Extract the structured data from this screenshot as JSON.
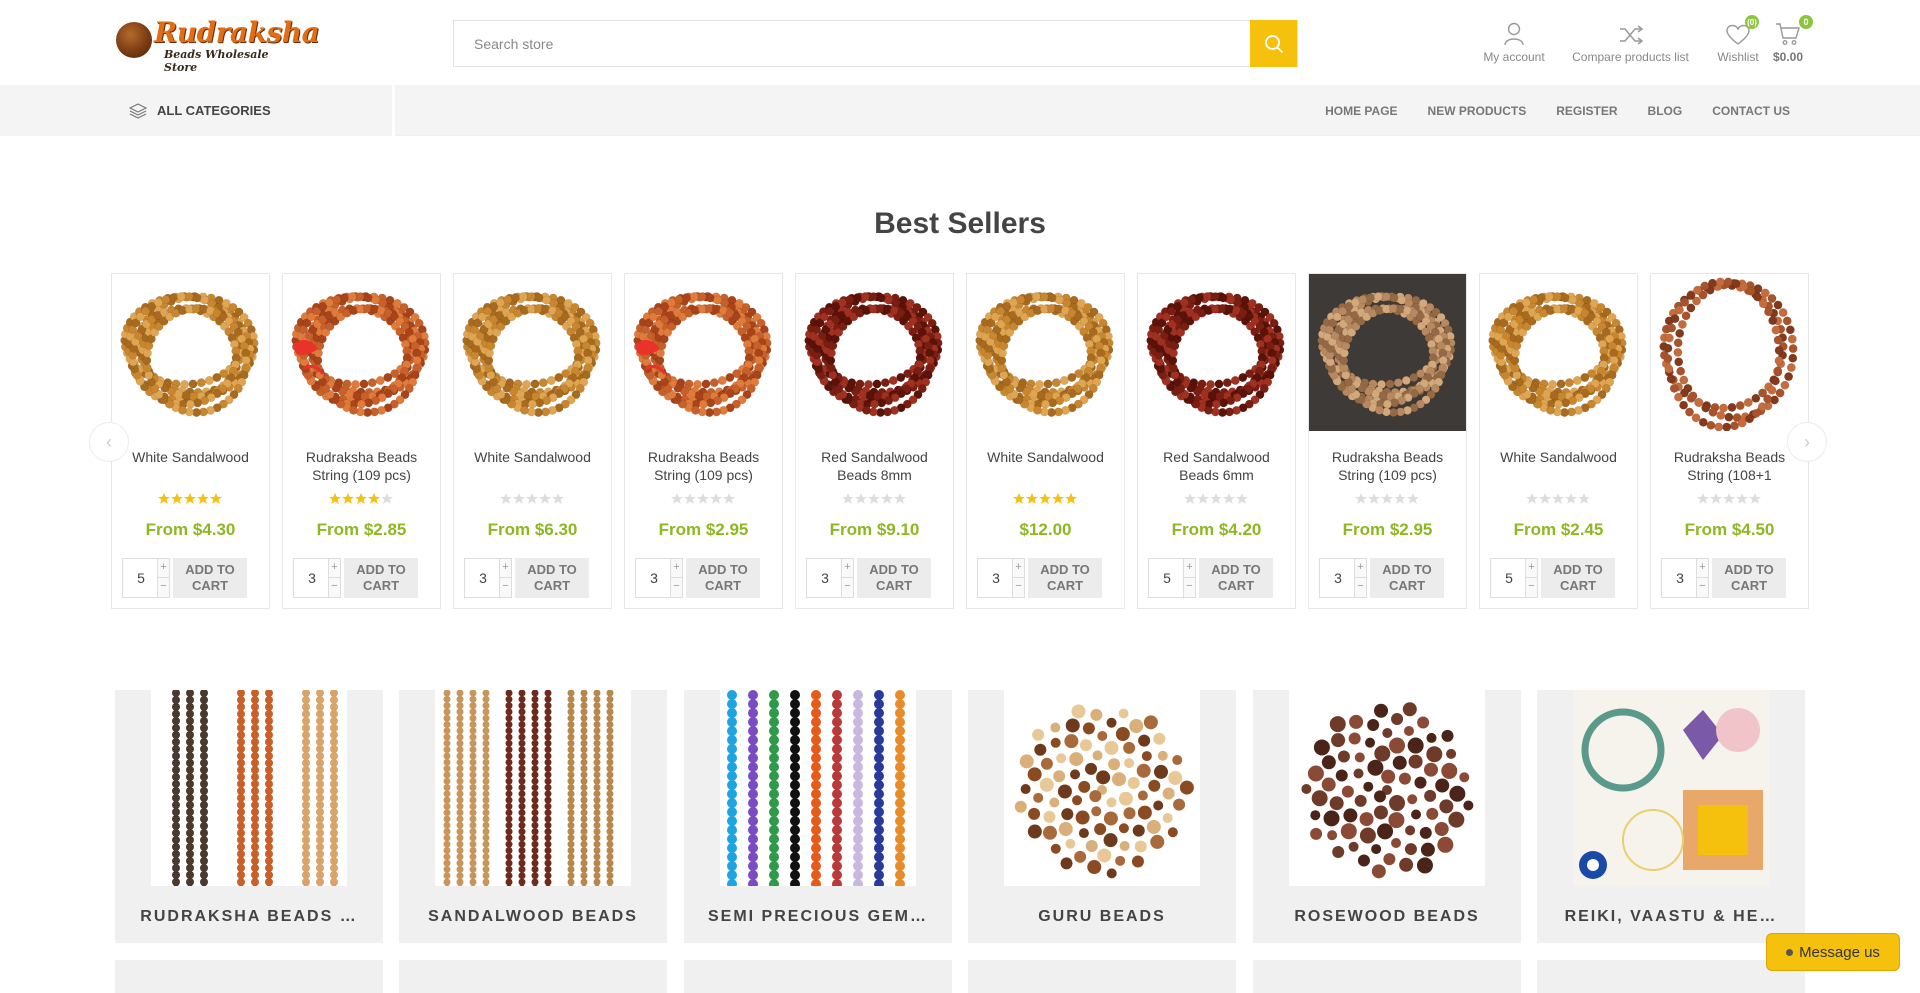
{
  "logo": {
    "title": "Rudraksha",
    "subtitle": "Beads Wholesale Store"
  },
  "search": {
    "placeholder": "Search store"
  },
  "header_links": {
    "account": "My account",
    "compare": "Compare products list",
    "wishlist": "Wishlist",
    "wishlist_count": "(0)",
    "cart_count": "0",
    "cart_total": "$0.00"
  },
  "nav": {
    "categories_label": "ALL CATEGORIES",
    "menu": [
      "HOME PAGE",
      "NEW PRODUCTS",
      "REGISTER",
      "BLOG",
      "CONTACT US"
    ]
  },
  "best_sellers": {
    "title": "Best Sellers",
    "add_to_cart": "ADD TO CART",
    "products": [
      {
        "name": "White Sandalwood",
        "price": "From $4.30",
        "rating": 5,
        "qty": "5",
        "image": "white-sandalwood-strings"
      },
      {
        "name": "Rudraksha Beads String (109 pcs)",
        "price": "From $2.85",
        "rating": 4,
        "qty": "3",
        "image": "rudraksha-strings"
      },
      {
        "name": "White Sandalwood",
        "price": "From $6.30",
        "rating": 0,
        "qty": "3",
        "image": "white-sandalwood-strings"
      },
      {
        "name": "Rudraksha Beads String (109 pcs)",
        "price": "From $2.95",
        "rating": 0,
        "qty": "3",
        "image": "rudraksha-strings"
      },
      {
        "name": "Red Sandalwood Beads 8mm",
        "price": "From $9.10",
        "rating": 0,
        "qty": "3",
        "image": "red-sandalwood-strings"
      },
      {
        "name": "White Sandalwood",
        "price": "$12.00",
        "rating": 5,
        "qty": "3",
        "image": "white-sandalwood-strings"
      },
      {
        "name": "Red Sandalwood Beads 6mm",
        "price": "From $4.20",
        "rating": 0,
        "qty": "5",
        "image": "red-sandalwood-strings"
      },
      {
        "name": "Rudraksha Beads String (109 pcs)",
        "price": "From $2.95",
        "rating": 0,
        "qty": "3",
        "image": "rudraksha-dark-photo"
      },
      {
        "name": "White Sandalwood",
        "price": "From $2.45",
        "rating": 0,
        "qty": "5",
        "image": "white-sandalwood-strings"
      },
      {
        "name": "Rudraksha Beads String (108+1",
        "price": "From $4.50",
        "rating": 0,
        "qty": "3",
        "image": "rudraksha-loose-strings"
      }
    ]
  },
  "categories": [
    {
      "name": "RUDRAKSHA BEADS …"
    },
    {
      "name": "SANDALWOOD BEADS"
    },
    {
      "name": "SEMI PRECIOUS GEM…"
    },
    {
      "name": "GURU BEADS"
    },
    {
      "name": "ROSEWOOD BEADS"
    },
    {
      "name": "REIKI, VAASTU & HE…"
    }
  ],
  "chat": {
    "label": "Message us"
  },
  "colors": {
    "accent": "#f5c10c",
    "price": "#8cb820",
    "badge": "#8cc63f"
  }
}
